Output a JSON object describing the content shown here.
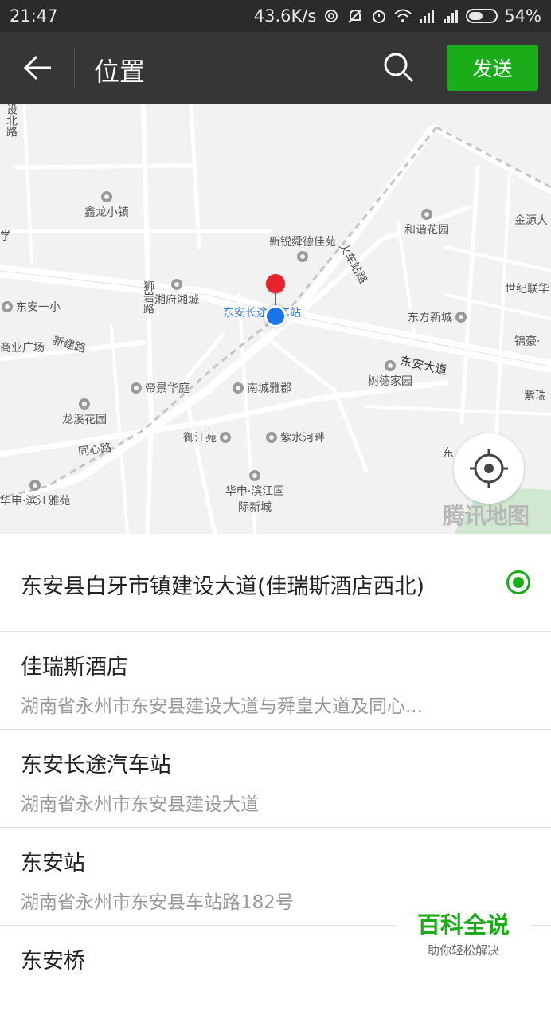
{
  "status_bar": {
    "time": "21:47",
    "net_speed": "43.6K/s",
    "battery": "54%",
    "battery_level": 0.54,
    "icons": [
      "hotspot-icon",
      "mute-icon",
      "alarm-icon",
      "wifi-icon",
      "signal-icon",
      "signal-icon",
      "battery-icon"
    ]
  },
  "header": {
    "title": "位置",
    "send_label": "发送",
    "back_icon": "arrow-left-icon",
    "search_icon": "search-icon"
  },
  "map": {
    "watermark": "腾讯地图",
    "roads": [
      "设北路",
      "狮岩路",
      "新建路",
      "同心路",
      "火车站路",
      "东安大道"
    ],
    "pois": [
      "鑫龙小镇",
      "新锐舜德佳苑",
      "和谐花园",
      "金源大",
      "东安一小",
      "湘府湘城",
      "东安长途汽车站",
      "东方新城",
      "世纪联华",
      "锦豪·",
      "商业广场",
      "帝景华庭",
      "南城雅郡",
      "树德家园",
      "紫瑞",
      "龙溪花园",
      "御江苑",
      "紫水河畔",
      "东",
      "华申·滨江雅苑",
      "华申·滨江国际新城"
    ],
    "partial_labels": [
      "学"
    ],
    "station_label": "东安长途汽车站"
  },
  "colors": {
    "accent": "#1aad19",
    "header_bg": "#363636",
    "status_bg": "#2b2b2b",
    "pin_red": "#e8222a",
    "location_blue": "#1a73e8"
  },
  "list": {
    "selected": {
      "name": "东安县白牙市镇建设大道(佳瑞斯酒店西北)"
    },
    "items": [
      {
        "name": "佳瑞斯酒店",
        "address": "湖南省永州市东安县建设大道与舜皇大道及同心..."
      },
      {
        "name": "东安长途汽车站",
        "address": "湖南省永州市东安县建设大道"
      },
      {
        "name": "东安站",
        "address": "湖南省永州市东安县车站路182号"
      },
      {
        "name": "东安桥",
        "address": ""
      }
    ]
  },
  "overlay": {
    "title": "百科全说",
    "subtitle": "助你轻松解决"
  }
}
